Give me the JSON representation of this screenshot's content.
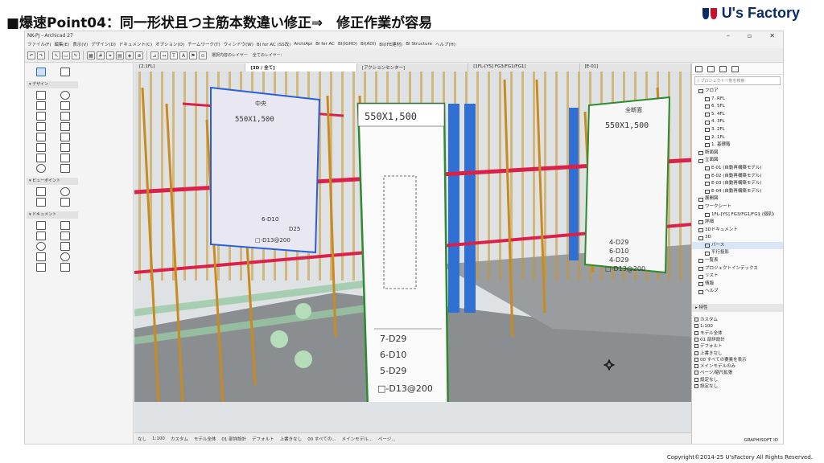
{
  "slide": {
    "title": "■爆速Point04：同一形状且つ主筋本数違い修正⇒　修正作業が容易",
    "brand": "U's Factory",
    "copyright": "Copyright©2014-25  U'sFactory All Rights Reserved."
  },
  "app": {
    "title": "NK-PJ - Archicad 27",
    "menus": [
      "ファイル(F)",
      "編集(E)",
      "表示(V)",
      "デザイン(D)",
      "ドキュメント(C)",
      "オプション(O)",
      "チームワーク(T)",
      "ウィンドウ(W)",
      "BI for AC (SS改)",
      "ArchiApi",
      "BI for AC",
      "BI(IGHD)",
      "BI(ADI)",
      "BI(IFE建材)",
      "BI Structure",
      "ヘルプ(H)"
    ],
    "layer_label": "選択内容のレイヤー",
    "layer_all": "全てのレイヤー:",
    "toolbox": {
      "design": "▾ デザイン",
      "viewpoint": "▾ ビューポイント",
      "document": "▾ ドキュメント"
    },
    "tabs": [
      {
        "label": "[2.1FL]",
        "active": false
      },
      {
        "label": "[3D / 全て]",
        "active": true
      },
      {
        "label": "[アクションセンター]",
        "active": false
      },
      {
        "label": "[1FL-[YS] FG3/FG1/FG1]",
        "active": false
      },
      {
        "label": "[E-01]",
        "active": false
      }
    ],
    "viewport": {
      "panel_mid_size": "550X1,500",
      "panel_left_size": "550X1,500",
      "panel_left_heading": "中央",
      "panel_left_labels": [
        "6-D10",
        "D25",
        "□-D13@200"
      ],
      "panel_right_size": "550X1,500",
      "panel_right_heading": "全断面",
      "panel_right_labels": [
        "4-D29",
        "6-D10",
        "4-D29",
        "□-D13@200"
      ],
      "panel_mid_labels": [
        "7-D29",
        "6-D10",
        "5-D29",
        "□-D13@200"
      ]
    },
    "statusbar": [
      "なし",
      "1:100",
      "カスタム",
      "モデル全体",
      "01 部詳設計",
      "デフォルト",
      "上書きなし",
      "00 すべての...",
      "メインモデル...",
      "ページ... "
    ],
    "navigator": {
      "search_placeholder": "プロジェクト一覧を検索",
      "tree": [
        {
          "label": "フロア",
          "indent": 0,
          "selected": false
        },
        {
          "label": "7. RFL",
          "indent": 1,
          "selected": false
        },
        {
          "label": "6. 5FL",
          "indent": 1,
          "selected": false
        },
        {
          "label": "5. 4FL",
          "indent": 1,
          "selected": false
        },
        {
          "label": "4. 3FL",
          "indent": 1,
          "selected": false
        },
        {
          "label": "3. 2FL",
          "indent": 1,
          "selected": false
        },
        {
          "label": "2. 1FL",
          "indent": 1,
          "selected": false
        },
        {
          "label": "1. 基礎階",
          "indent": 1,
          "selected": false
        },
        {
          "label": "断面図",
          "indent": 0,
          "selected": false
        },
        {
          "label": "立面図",
          "indent": 0,
          "selected": false
        },
        {
          "label": "E-01 (自動再構築モデル)",
          "indent": 1,
          "selected": false
        },
        {
          "label": "E-02 (自動再構築モデル)",
          "indent": 1,
          "selected": false
        },
        {
          "label": "E-03 (自動再構築モデル)",
          "indent": 1,
          "selected": false
        },
        {
          "label": "E-04 (自動再構築モデル)",
          "indent": 1,
          "selected": false
        },
        {
          "label": "展開図",
          "indent": 0,
          "selected": false
        },
        {
          "label": "ワークシート",
          "indent": 0,
          "selected": false
        },
        {
          "label": "1FL-[YS] FG3/FG1/FG1 (個別)",
          "indent": 1,
          "selected": false
        },
        {
          "label": "詳細",
          "indent": 0,
          "selected": false
        },
        {
          "label": "3Dドキュメント",
          "indent": 0,
          "selected": false
        },
        {
          "label": "3D",
          "indent": 0,
          "selected": false
        },
        {
          "label": "パース",
          "indent": 1,
          "selected": true
        },
        {
          "label": "平行投影",
          "indent": 1,
          "selected": false
        },
        {
          "label": "一覧表",
          "indent": 0,
          "selected": false
        },
        {
          "label": "プロジェクトインデックス",
          "indent": 0,
          "selected": false
        },
        {
          "label": "リスト",
          "indent": 0,
          "selected": false
        },
        {
          "label": "情報",
          "indent": 0,
          "selected": false
        },
        {
          "label": "ヘルプ",
          "indent": 0,
          "selected": false
        }
      ],
      "props_head": "▸ 特性",
      "props": [
        "カスタム",
        "1:100",
        "モデル全体",
        "01 部詳設計",
        "デフォルト",
        "上書きなし",
        "00 すべての要素を表示",
        "メインモデルのみ",
        "ページ/縮尺拡張",
        "設定なし",
        "設定なし"
      ],
      "footer": "GRAPHISOFT ID"
    }
  }
}
